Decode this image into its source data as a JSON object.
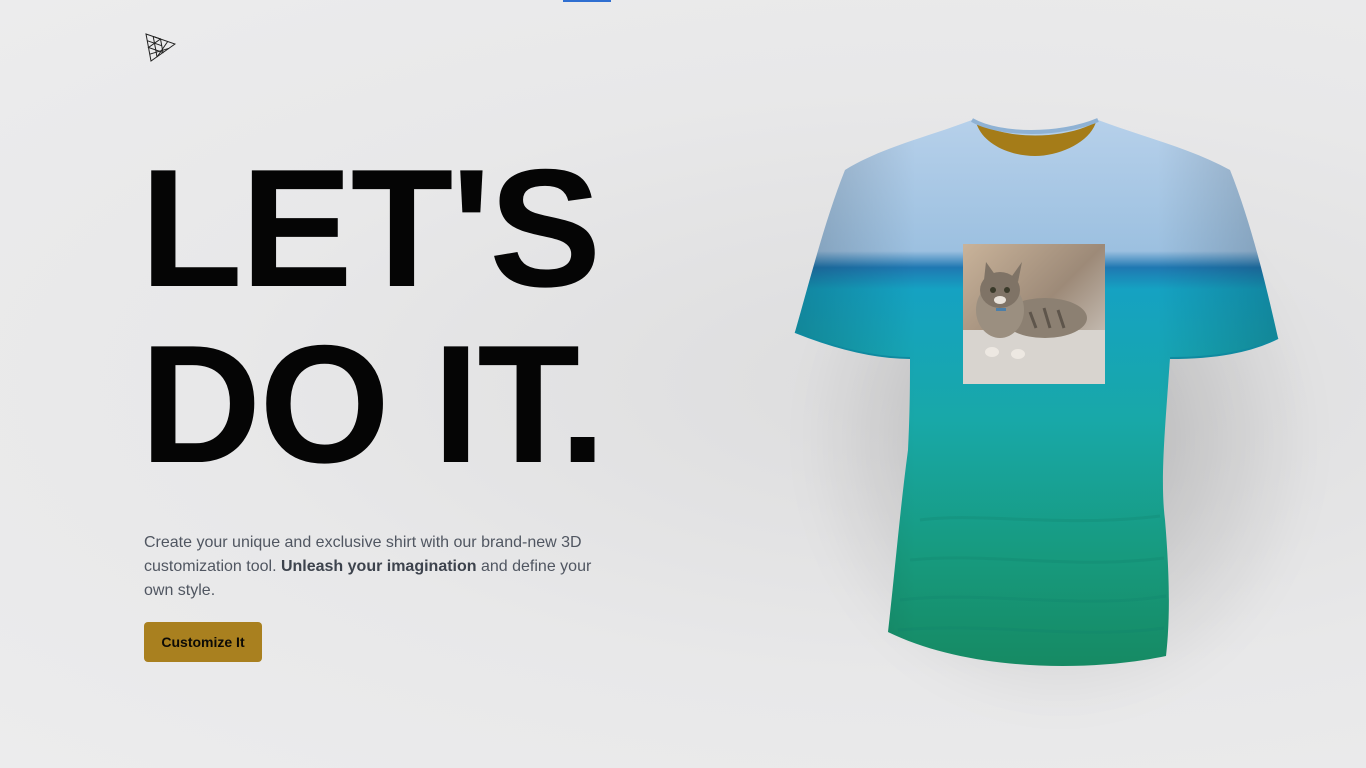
{
  "hero": {
    "headline_line1": "LET'S",
    "headline_line2": "DO IT.",
    "description_part1": "Create your unique and exclusive shirt with our brand-new 3D customization tool. ",
    "description_bold": "Unleash your imagination",
    "description_part2": " and define your own style.",
    "cta_label": "Customize It"
  },
  "colors": {
    "accent": "#a9801f",
    "shirt_top": "#a9c8e4",
    "shirt_sea": "#1fa3b4",
    "shirt_bottom": "#1c9470",
    "collar_inner": "#a57c18",
    "top_indicator": "#2f6fd1"
  },
  "icons": {
    "logo": "threejs-triangle-logo"
  },
  "shirt": {
    "decal": "cat-photo"
  }
}
